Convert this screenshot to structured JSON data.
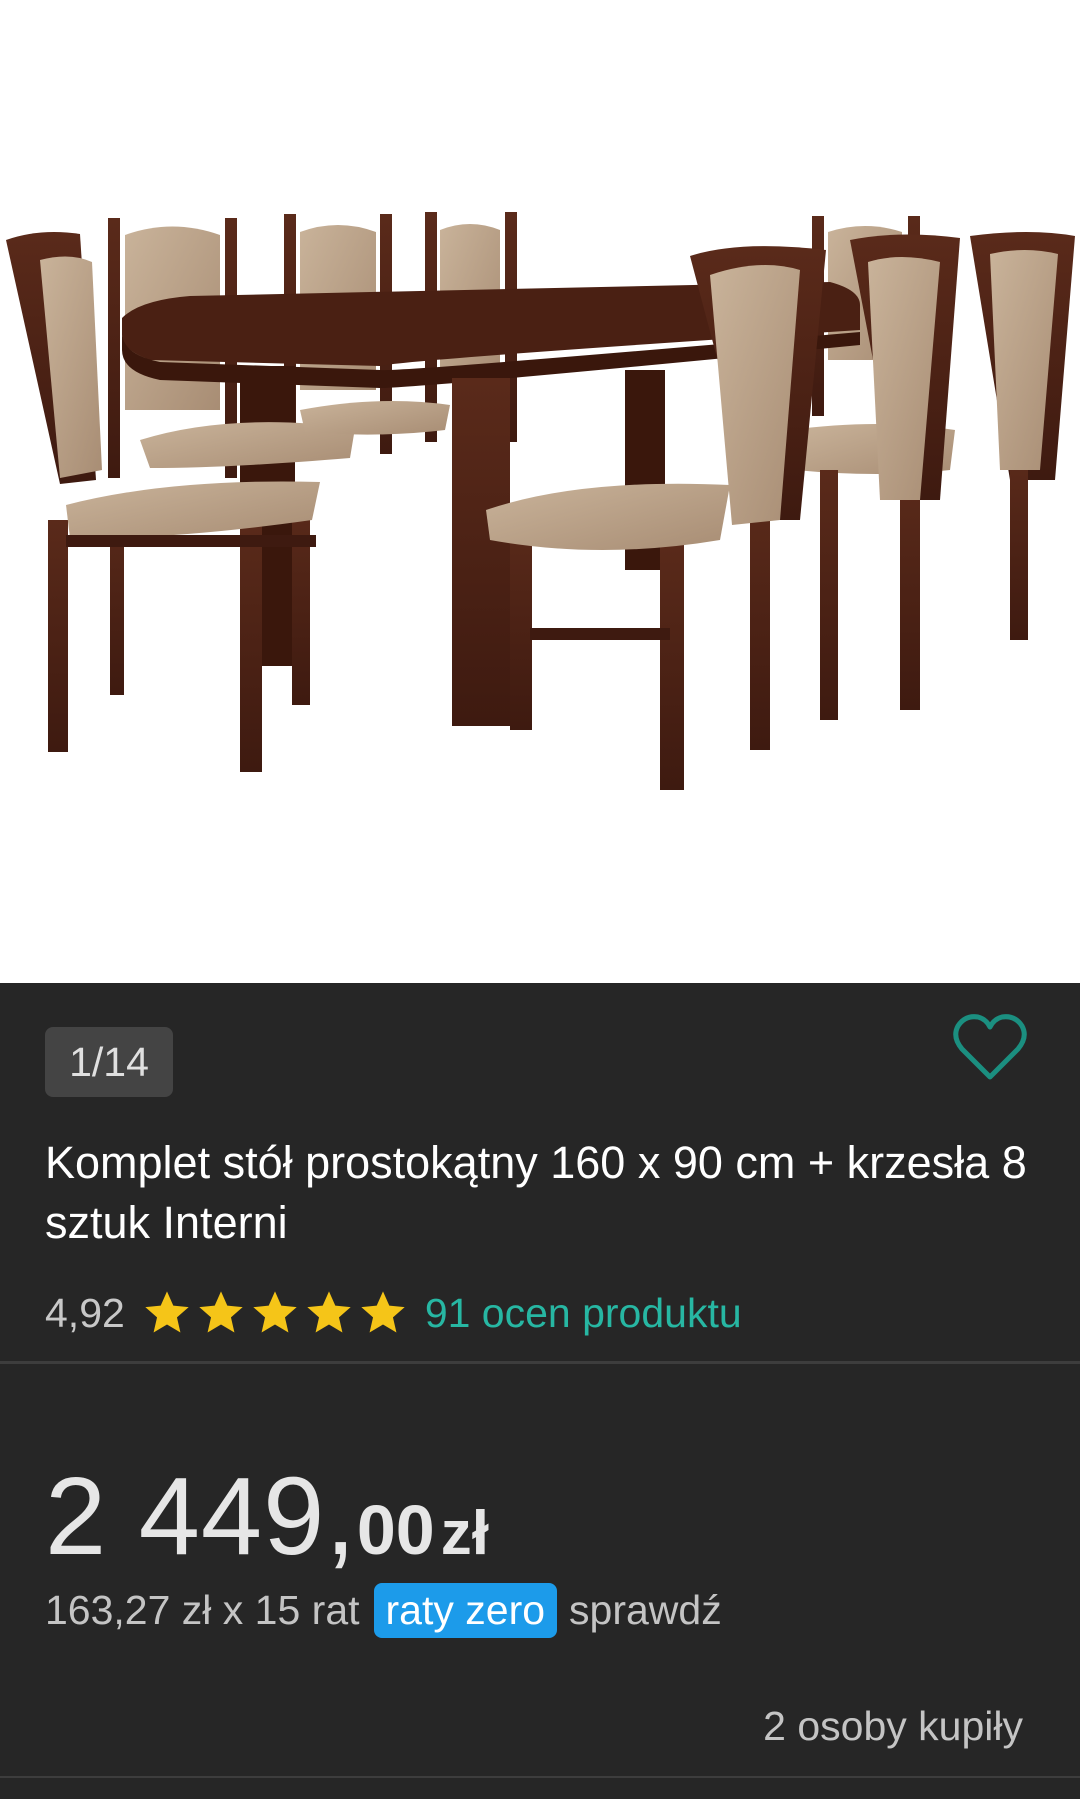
{
  "gallery": {
    "counter": "1/14"
  },
  "product": {
    "title": "Komplet stół prostokątny 160 x 90 cm + krzesła 8 sztuk Interni",
    "rating_value": "4,92",
    "rating_stars": 5,
    "rating_link": "91 ocen produktu"
  },
  "price": {
    "main": "2 449,",
    "fraction": "00",
    "currency": "zł"
  },
  "installments": {
    "text": "163,27 zł x 15 rat",
    "badge": "raty zero",
    "link": "sprawdź"
  },
  "buyers": "2 osoby kupiły",
  "icons": {
    "favorite": "heart-outline-icon",
    "star": "star-icon"
  },
  "colors": {
    "accent": "#27b7a3",
    "badge": "#1c9bea",
    "star": "#f5c518",
    "panel": "#262626"
  }
}
